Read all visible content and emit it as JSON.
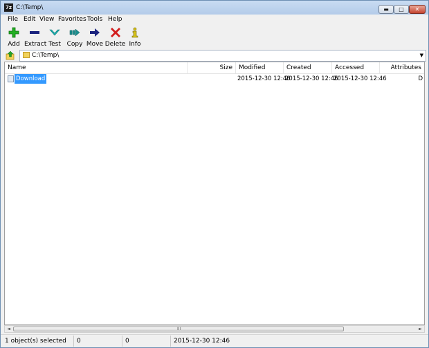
{
  "window": {
    "title": "C:\\Temp\\",
    "app_icon_text": "7z",
    "controls": {
      "minimize": "▬",
      "maximize": "□",
      "close": "✕"
    }
  },
  "menu": [
    "File",
    "Edit",
    "View",
    "Favorites",
    "Tools",
    "Help"
  ],
  "toolbar": [
    {
      "label": "Add",
      "icon": "add-icon",
      "color": "#1aa81a"
    },
    {
      "label": "Extract",
      "icon": "extract-icon",
      "color": "#1a237e"
    },
    {
      "label": "Test",
      "icon": "test-icon",
      "color": "#1aa5a5"
    },
    {
      "label": "Copy",
      "icon": "copy-icon",
      "color": "#1a8a8a"
    },
    {
      "label": "Move",
      "icon": "move-icon",
      "color": "#1a237e"
    },
    {
      "label": "Delete",
      "icon": "delete-icon",
      "color": "#d21e1e"
    },
    {
      "label": "Info",
      "icon": "info-icon",
      "color": "#d6c21a"
    }
  ],
  "address": {
    "path": "C:\\Temp\\",
    "dropdown_arrow": "▼"
  },
  "columns": [
    "Name",
    "Size",
    "Modified",
    "Created",
    "Accessed",
    "Attributes"
  ],
  "rows": [
    {
      "name": "Download",
      "size": "",
      "modified": "2015-12-30 12:46",
      "created": "2015-12-30 12:46",
      "accessed": "2015-12-30 12:46",
      "attributes": "D",
      "selected": true
    }
  ],
  "scrollbar": {
    "left": "◄",
    "right": "►",
    "grip": "III"
  },
  "status": {
    "selection": "1 object(s) selected",
    "size": "0",
    "packed": "0",
    "date": "2015-12-30 12:46"
  }
}
